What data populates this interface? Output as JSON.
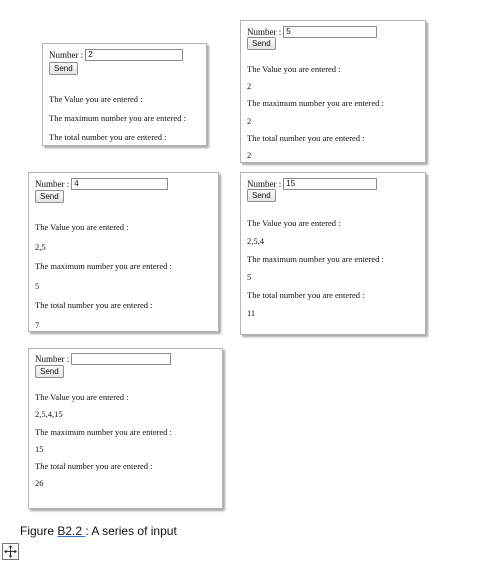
{
  "panels": [
    {
      "number_label": "Number :",
      "input_value": "2",
      "send_label": "Send",
      "value_heading": "The Value you are entered :",
      "value_list": "",
      "max_heading": "The maximum number you are entered :",
      "max_value": "",
      "total_heading": "The total number you are entered :",
      "total_value": ""
    },
    {
      "number_label": "Number :",
      "input_value": "5",
      "send_label": "Send",
      "value_heading": "The Value you are entered :",
      "value_list": "2",
      "max_heading": "The maximum number you are entered :",
      "max_value": "2",
      "total_heading": "The total number you are entered :",
      "total_value": "2"
    },
    {
      "number_label": "Number :",
      "input_value": "4",
      "send_label": "Send",
      "value_heading": "The Value you are entered :",
      "value_list": "2,5",
      "max_heading": "The maximum number you are entered :",
      "max_value": "5",
      "total_heading": "The total number you are entered :",
      "total_value": "7"
    },
    {
      "number_label": "Number :",
      "input_value": "15",
      "send_label": "Send",
      "value_heading": "The Value you are entered :",
      "value_list": "2,5,4",
      "max_heading": "The maximum number you are entered :",
      "max_value": "5",
      "total_heading": "The total number you are entered :",
      "total_value": "11"
    },
    {
      "number_label": "Number :",
      "input_value": "",
      "send_label": "Send",
      "value_heading": "The Value you are entered :",
      "value_list": "2,5,4,15",
      "max_heading": "The maximum number you are entered :",
      "max_value": "15",
      "total_heading": "The total number you are entered :",
      "total_value": "26"
    }
  ],
  "caption": {
    "prefix": "Figure ",
    "number": "B2.2 ",
    "separator": ":",
    "text": " A series of input"
  },
  "icons": {
    "move_handle": "move-arrows-icon"
  }
}
